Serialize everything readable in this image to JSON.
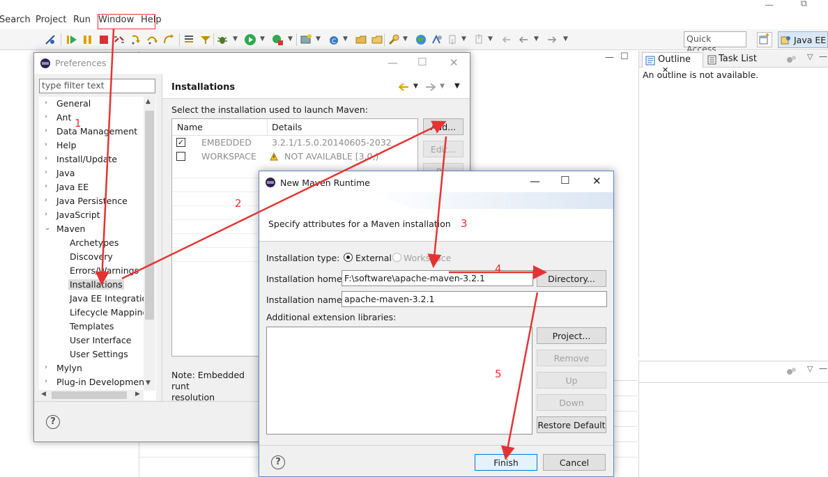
{
  "menubar": {
    "items": [
      "Search",
      "Project",
      "Run",
      "Window",
      "Help"
    ]
  },
  "toolbar": {
    "quick_access_placeholder": "Quick Access",
    "perspective_label": "Java EE",
    "icons": [
      "skip-breakpoints-icon",
      "resume-icon",
      "suspend-icon",
      "terminate-icon",
      "disconnect-icon",
      "step-into-icon",
      "step-over-icon",
      "step-return-icon",
      "drop-to-frame-icon",
      "use-step-filters-icon",
      "debug-icon",
      "run-icon",
      "run-external-tool-icon",
      "new-server-icon",
      "new-class-icon",
      "open-type-icon",
      "open-task-icon",
      "search-icon",
      "globe-icon",
      "annotation-icon",
      "back-icon",
      "forward-icon"
    ]
  },
  "outline": {
    "tab_label": "Outline",
    "tab_close": "✕",
    "task_tab_label": "Task List",
    "message": "An outline is not available."
  },
  "preferences": {
    "title": "Preferences",
    "filter_placeholder": "type filter text",
    "tree": [
      {
        "label": "General",
        "level": 0,
        "caret": "›"
      },
      {
        "label": "Ant",
        "level": 0,
        "caret": "›"
      },
      {
        "label": "Data Management",
        "level": 0,
        "caret": "›"
      },
      {
        "label": "Help",
        "level": 0,
        "caret": "›"
      },
      {
        "label": "Install/Update",
        "level": 0,
        "caret": "›"
      },
      {
        "label": "Java",
        "level": 0,
        "caret": "›"
      },
      {
        "label": "Java EE",
        "level": 0,
        "caret": "›"
      },
      {
        "label": "Java Persistence",
        "level": 0,
        "caret": "›"
      },
      {
        "label": "JavaScript",
        "level": 0,
        "caret": "›"
      },
      {
        "label": "Maven",
        "level": 0,
        "caret": "⌄"
      },
      {
        "label": "Archetypes",
        "level": 1
      },
      {
        "label": "Discovery",
        "level": 1
      },
      {
        "label": "Errors/Warnings",
        "level": 1
      },
      {
        "label": "Installations",
        "level": 1,
        "selected": true
      },
      {
        "label": "Java EE Integration",
        "level": 1
      },
      {
        "label": "Lifecycle Mappings",
        "level": 1
      },
      {
        "label": "Templates",
        "level": 1
      },
      {
        "label": "User Interface",
        "level": 1
      },
      {
        "label": "User Settings",
        "level": 1
      },
      {
        "label": "Mylyn",
        "level": 0,
        "caret": "›"
      },
      {
        "label": "Plug-in Development",
        "level": 0,
        "caret": "›"
      }
    ],
    "page_title": "Installations",
    "prompt": "Select the installation used to launch Maven:",
    "columns": [
      "Name",
      "Details"
    ],
    "rows": [
      {
        "checked": true,
        "name": "EMBEDDED",
        "details": "3.2.1/1.5.0.20140605-2032"
      },
      {
        "checked": false,
        "name": "WORKSPACE",
        "details": "NOT AVAILABLE [3.0,)"
      }
    ],
    "buttons": {
      "add": "Add...",
      "edit": "Edit...",
      "remove": "R..."
    },
    "note": "Note: Embedded runt resolution",
    "note_line1": "Note: Embedded runt",
    "note_line2": "resolution"
  },
  "maven_dialog": {
    "title": "New Maven Runtime",
    "banner": "Specify attributes for a Maven installation",
    "installation_type_label": "Installation type:",
    "type_external": "External",
    "type_workspace": "Workspace",
    "selected_type": "External",
    "home_label": "Installation home:",
    "home_value": "F:\\software\\apache-maven-3.2.1",
    "directory_button": "Directory...",
    "name_label": "Installation name:",
    "name_value": "apache-maven-3.2.1",
    "ext_label": "Additional extension libraries:",
    "side_buttons": {
      "project": "Project...",
      "remove": "Remove",
      "up": "Up",
      "down": "Down",
      "restore": "Restore Default"
    },
    "finish": "Finish",
    "cancel": "Cancel"
  },
  "annotations": {
    "labels": [
      "1",
      "2",
      "3",
      "4",
      "5"
    ],
    "color": "#e53333"
  },
  "window_controls": {
    "minimize": "—",
    "maximize": "☐",
    "close": "✕",
    "help": "?"
  }
}
